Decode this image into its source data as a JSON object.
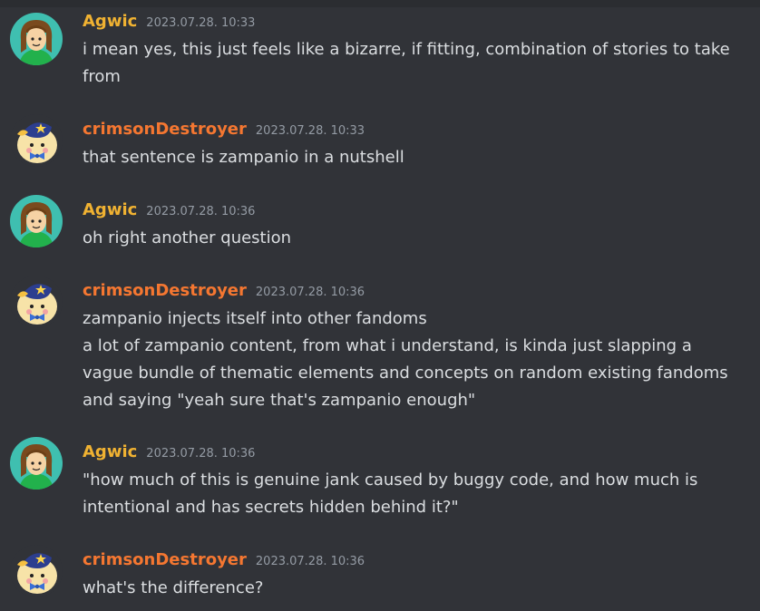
{
  "colors": {
    "background": "#313338",
    "author_agwic": "#f0b232",
    "author_crimson": "#f57731",
    "text": "#dbdee1",
    "timestamp": "#949ba4"
  },
  "messages": [
    {
      "author": "Agwic",
      "timestamp": "2023.07.28. 10:33",
      "avatar_icon": "agwic-avatar-icon",
      "lines": [
        "i mean yes, this just feels like a bizarre, if fitting, combination of stories to take",
        "from"
      ]
    },
    {
      "author": "crimsonDestroyer",
      "timestamp": "2023.07.28. 10:33",
      "avatar_icon": "crimson-avatar-icon",
      "lines": [
        "that sentence is zampanio in a nutshell"
      ]
    },
    {
      "author": "Agwic",
      "timestamp": "2023.07.28. 10:36",
      "avatar_icon": "agwic-avatar-icon",
      "lines": [
        "oh right another question"
      ]
    },
    {
      "author": "crimsonDestroyer",
      "timestamp": "2023.07.28. 10:36",
      "avatar_icon": "crimson-avatar-icon",
      "lines": [
        "zampanio injects itself into other fandoms",
        "a lot of zampanio content, from what i understand, is kinda just slapping a",
        "vague bundle of thematic elements and concepts on random existing fandoms",
        "and saying \"yeah sure that's zampanio enough\""
      ]
    },
    {
      "author": "Agwic",
      "timestamp": "2023.07.28. 10:36",
      "avatar_icon": "agwic-avatar-icon",
      "lines": [
        "\"how much of this is genuine jank caused by buggy code, and how much is",
        "intentional and has secrets hidden behind it?\""
      ]
    },
    {
      "author": "crimsonDestroyer",
      "timestamp": "2023.07.28. 10:36",
      "avatar_icon": "crimson-avatar-icon",
      "lines": [
        "what's the difference?"
      ]
    }
  ]
}
